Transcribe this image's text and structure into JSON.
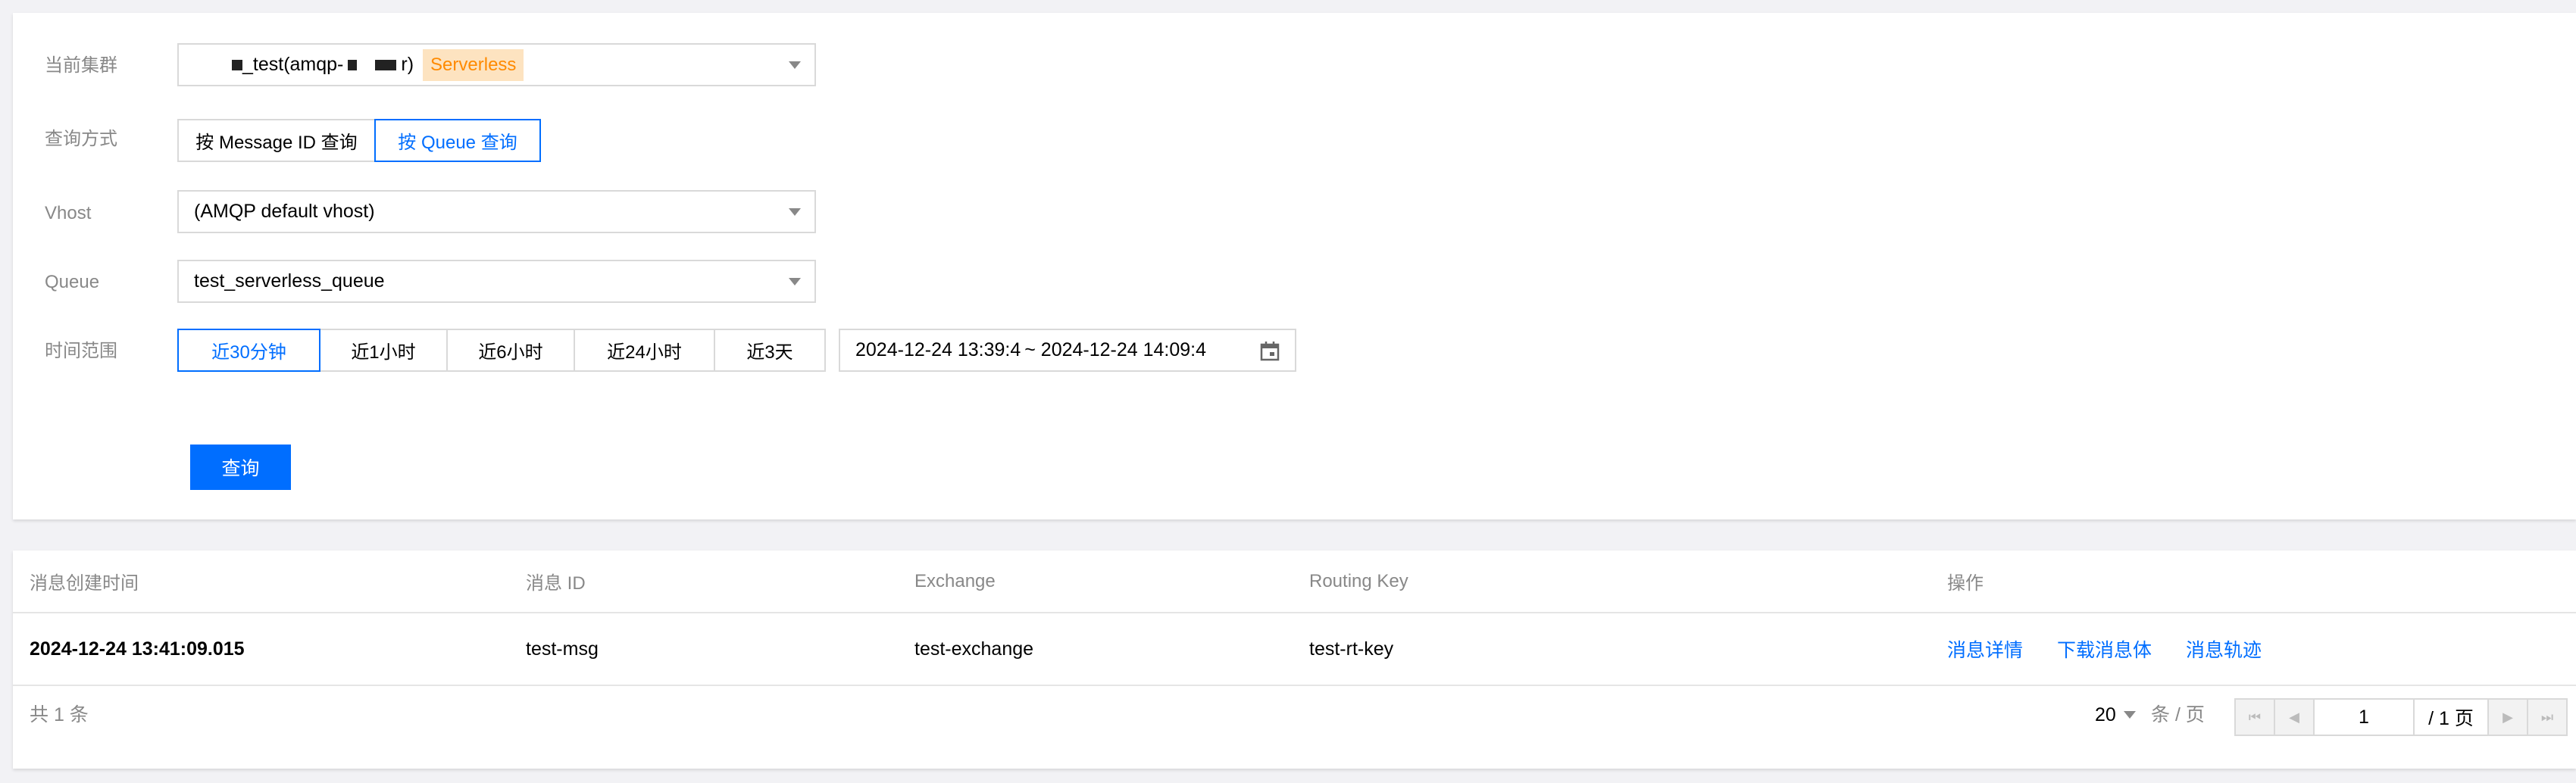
{
  "query": {
    "cluster": {
      "label": "当前集群",
      "value_prefix": "",
      "value_name": "_test(amqp-",
      "value_suffix": "r)",
      "badge": "Serverless"
    },
    "mode": {
      "label": "查询方式",
      "options": [
        "按 Message ID 查询",
        "按 Queue 查询"
      ],
      "selected": "按 Queue 查询"
    },
    "vhost": {
      "label": "Vhost",
      "value": "(AMQP default vhost)"
    },
    "queue": {
      "label": "Queue",
      "value": "test_serverless_queue"
    },
    "time_range": {
      "label": "时间范围",
      "options": [
        "近30分钟",
        "近1小时",
        "近6小时",
        "近24小时",
        "近3天"
      ],
      "selected": "近30分钟",
      "range_text": "2024-12-24 13:39:4 ~ 2024-12-24 14:09:4"
    },
    "submit_label": "查询"
  },
  "results": {
    "columns": [
      "消息创建时间",
      "消息 ID",
      "Exchange",
      "Routing Key",
      "操作"
    ],
    "rows": [
      {
        "created": "2024-12-24 13:41:09.015",
        "message_id": "test-msg",
        "exchange": "test-exchange",
        "routing_key": "test-rt-key",
        "actions": [
          "消息详情",
          "下载消息体",
          "消息轨迹"
        ]
      }
    ],
    "total_text": "共 1 条",
    "page_size": "20",
    "page_size_unit": "条 / 页",
    "current_page": "1",
    "page_total": "/ 1 页"
  },
  "colors": {
    "accent": "#006eff",
    "badge_bg": "#fde3c0",
    "badge_text": "#ff8a00"
  }
}
